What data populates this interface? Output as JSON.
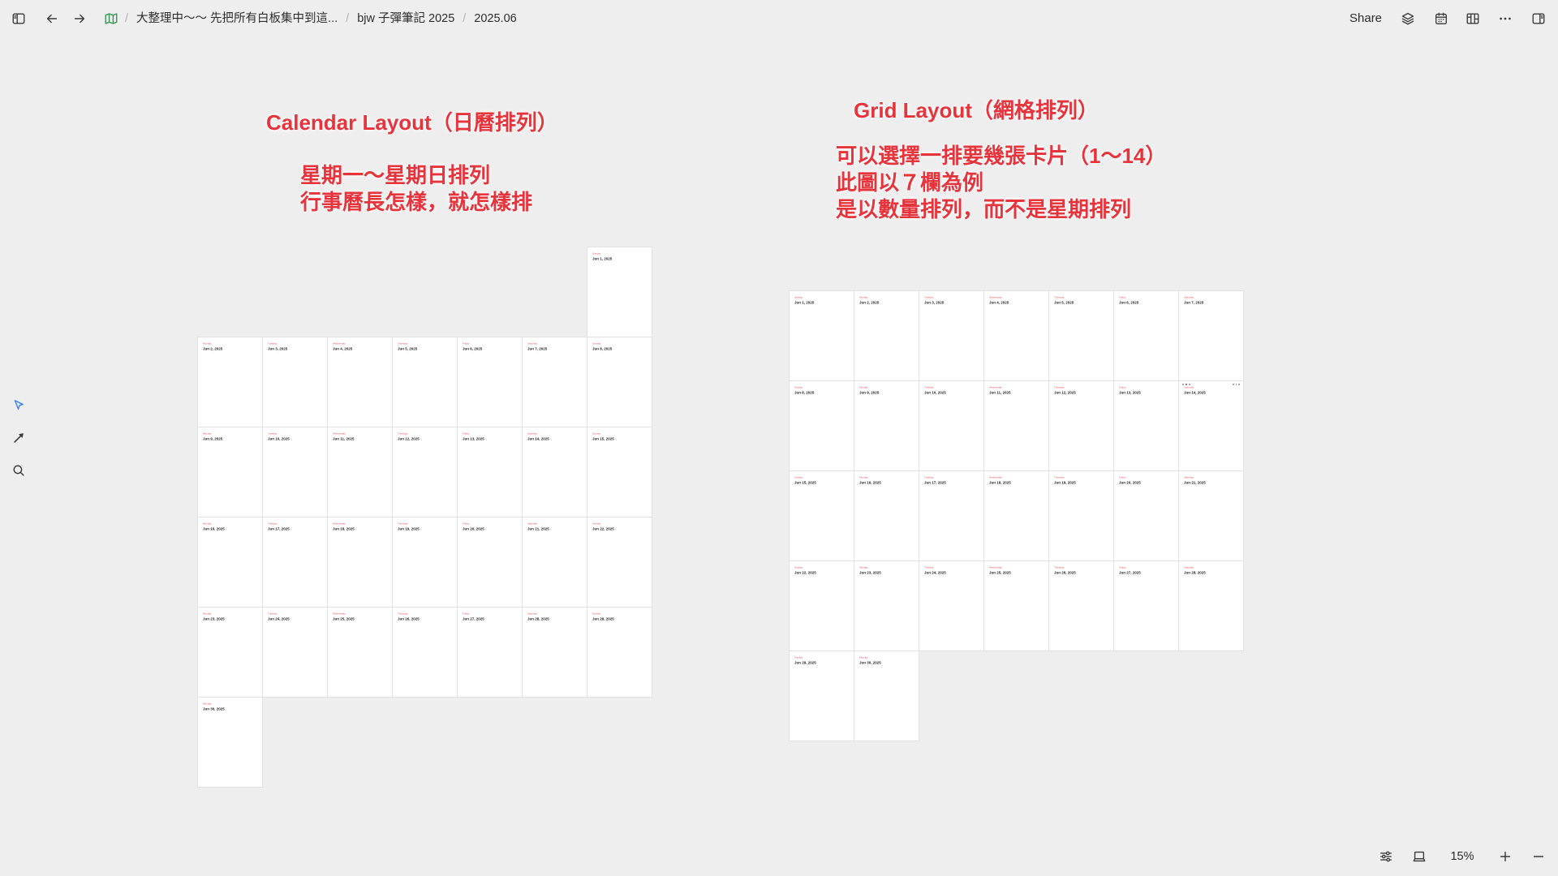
{
  "topbar": {
    "breadcrumbs": [
      "大整理中～～ 先把所有白板集中到這...",
      "bjw 子彈筆記 2025",
      "2025.06"
    ],
    "separator": "/",
    "share_label": "Share"
  },
  "icons": {
    "left_sidebar_toggle": "sidebar-left-icon",
    "back": "arrow-left-icon",
    "forward": "arrow-right-icon",
    "whiteboard": "map-icon",
    "layers": "layers-icon",
    "calendar": "calendar-icon",
    "card_library": "library-icon",
    "more": "more-horizontal-icon",
    "right_sidebar_toggle": "sidebar-right-icon",
    "select_tool": "cursor-icon",
    "connector_tool": "connector-arrow-icon",
    "search_tool": "search-icon",
    "view_settings": "sliders-icon",
    "fit_to_screen": "frame-icon",
    "zoom_in": "plus-icon",
    "zoom_out": "minus-icon"
  },
  "colors": {
    "canvas_background": "#eeeeee",
    "annotation_red": "#e6343d",
    "weekday_red": "#e8505a",
    "select_tool_blue": "#3b82f6",
    "whiteboard_icon_green": "#3a9a5b",
    "card_background": "#ffffff",
    "card_border": "#e2e2e2"
  },
  "calendar_layout": {
    "title": "Calendar Layout（日曆排列）",
    "notes": [
      "星期一～星期日排列",
      "行事曆長怎樣，就怎樣排"
    ]
  },
  "grid_layout": {
    "title": "Grid Layout（網格排列）",
    "notes": [
      "可以選擇一排要幾張卡片（1～14）",
      "此圖以７欄為例",
      "是以數量排列，而不是星期排列"
    ],
    "columns": 7
  },
  "journal_cards": [
    {
      "weekday": "Sunday",
      "date": "Jun 1, 2025"
    },
    {
      "weekday": "Monday",
      "date": "Jun 2, 2025"
    },
    {
      "weekday": "Tuesday",
      "date": "Jun 3, 2025"
    },
    {
      "weekday": "Wednesday",
      "date": "Jun 4, 2025"
    },
    {
      "weekday": "Thursday",
      "date": "Jun 5, 2025"
    },
    {
      "weekday": "Friday",
      "date": "Jun 6, 2025"
    },
    {
      "weekday": "Saturday",
      "date": "Jun 7, 2025"
    },
    {
      "weekday": "Sunday",
      "date": "Jun 8, 2025"
    },
    {
      "weekday": "Monday",
      "date": "Jun 9, 2025"
    },
    {
      "weekday": "Tuesday",
      "date": "Jun 10, 2025"
    },
    {
      "weekday": "Wednesday",
      "date": "Jun 11, 2025"
    },
    {
      "weekday": "Thursday",
      "date": "Jun 12, 2025"
    },
    {
      "weekday": "Friday",
      "date": "Jun 13, 2025"
    },
    {
      "weekday": "Saturday",
      "date": "Jun 14, 2025",
      "hovered_in_grid": true
    },
    {
      "weekday": "Sunday",
      "date": "Jun 15, 2025"
    },
    {
      "weekday": "Monday",
      "date": "Jun 16, 2025"
    },
    {
      "weekday": "Tuesday",
      "date": "Jun 17, 2025"
    },
    {
      "weekday": "Wednesday",
      "date": "Jun 18, 2025"
    },
    {
      "weekday": "Thursday",
      "date": "Jun 19, 2025"
    },
    {
      "weekday": "Friday",
      "date": "Jun 20, 2025"
    },
    {
      "weekday": "Saturday",
      "date": "Jun 21, 2025"
    },
    {
      "weekday": "Sunday",
      "date": "Jun 22, 2025"
    },
    {
      "weekday": "Monday",
      "date": "Jun 23, 2025"
    },
    {
      "weekday": "Tuesday",
      "date": "Jun 24, 2025"
    },
    {
      "weekday": "Wednesday",
      "date": "Jun 25, 2025"
    },
    {
      "weekday": "Thursday",
      "date": "Jun 26, 2025"
    },
    {
      "weekday": "Friday",
      "date": "Jun 27, 2025"
    },
    {
      "weekday": "Saturday",
      "date": "Jun 28, 2025"
    },
    {
      "weekday": "Sunday",
      "date": "Jun 29, 2025"
    },
    {
      "weekday": "Monday",
      "date": "Jun 30, 2025"
    }
  ],
  "zoom": {
    "level": "15%"
  }
}
